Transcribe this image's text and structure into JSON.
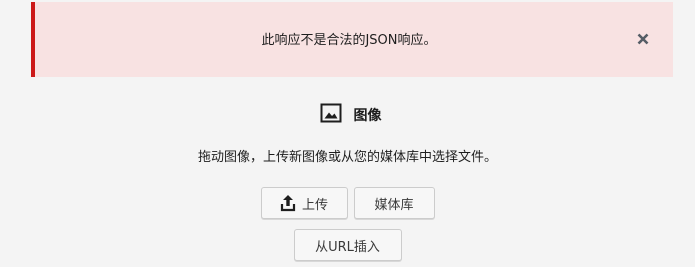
{
  "notice": {
    "message": "此响应不是合法的JSON响应。",
    "close_icon": "close-icon",
    "status_color": "#cc1818"
  },
  "placeholder": {
    "label": "图像",
    "label_icon": "image-icon",
    "instructions": "拖动图像，上传新图像或从您的媒体库中选择文件。",
    "upload_label": "上传",
    "upload_icon": "upload-icon",
    "media_library_label": "媒体库",
    "insert_from_url_label": "从URL插入"
  }
}
